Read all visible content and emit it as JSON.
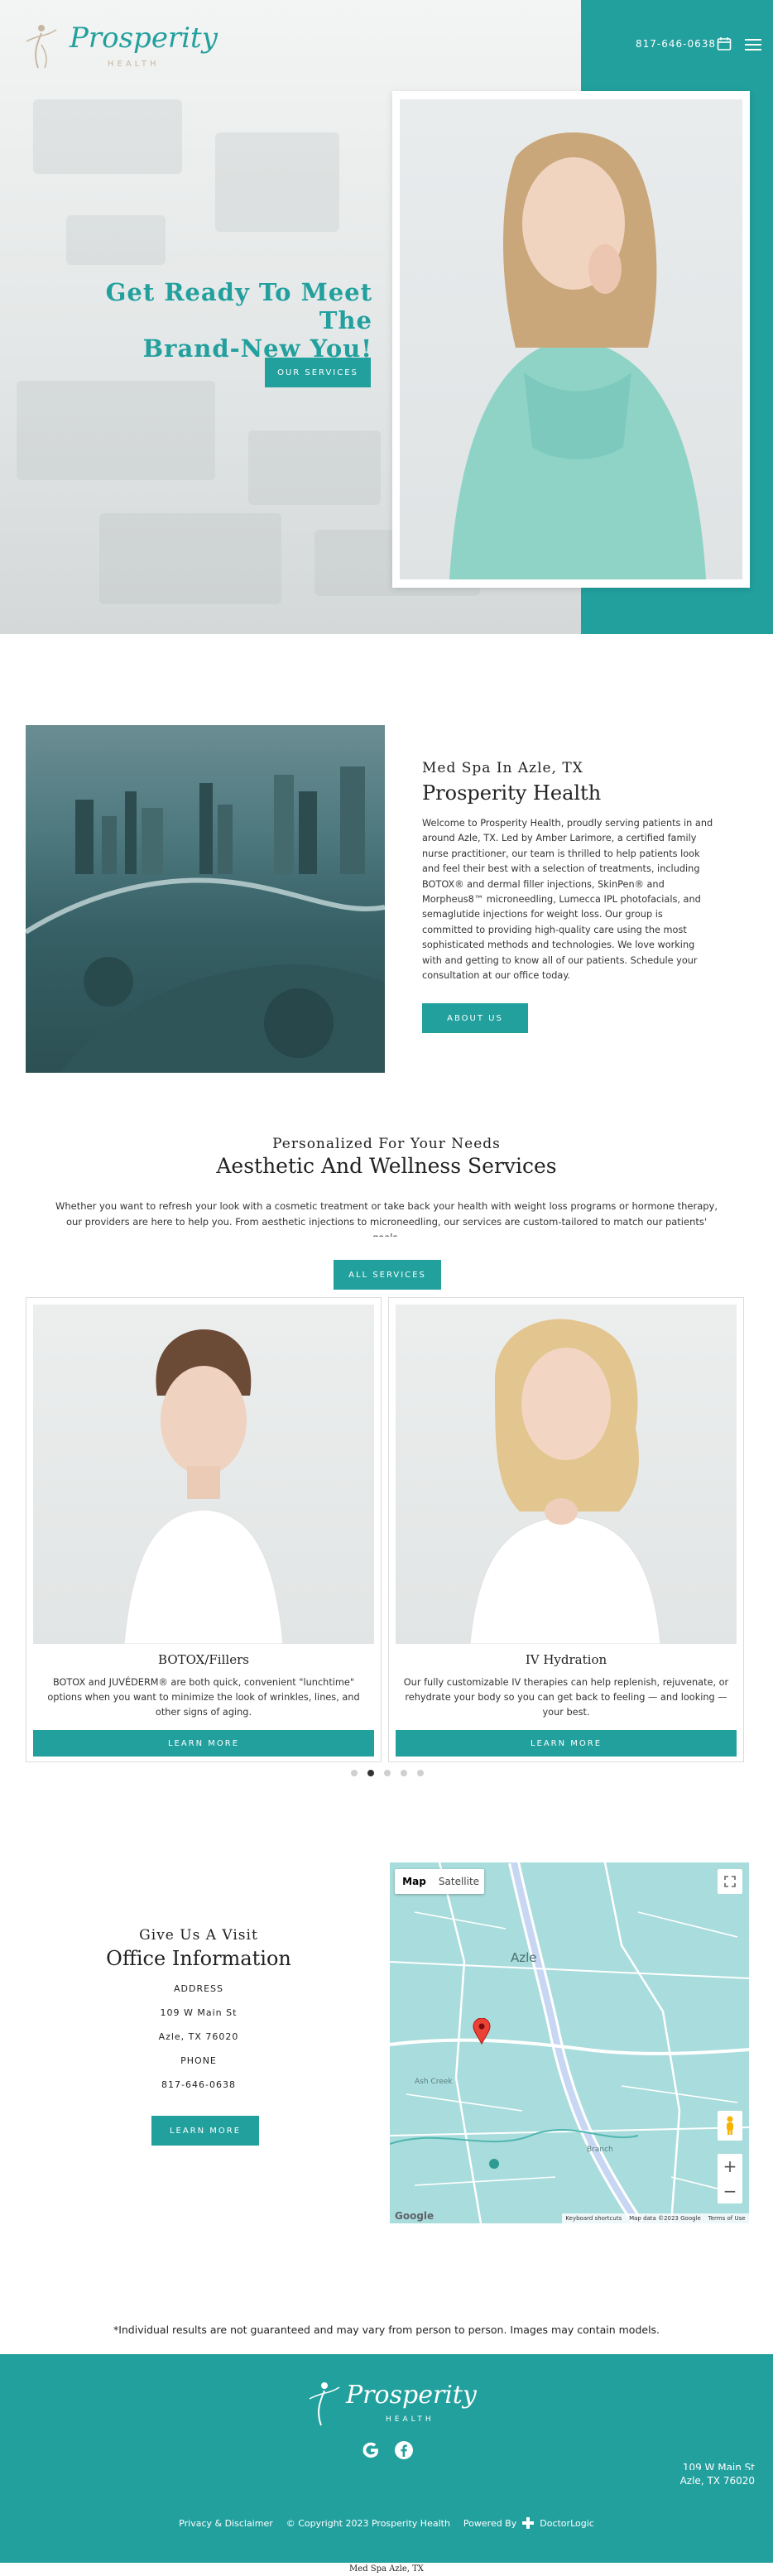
{
  "header": {
    "logo_text": "Prosperity",
    "logo_sub": "HEALTH",
    "phone": "817-646-0638",
    "calendar_icon": "calendar-icon",
    "menu_icon": "hamburger-menu-icon"
  },
  "hero": {
    "title_line1": "Get Ready To Meet The",
    "title_line2": "Brand-New You!",
    "button": "Our Services"
  },
  "about": {
    "subtitle": "Med Spa In Azle, TX",
    "title": "Prosperity Health",
    "text": "Welcome to Prosperity Health, proudly serving patients in and around Azle, TX. Led by Amber Larimore, a certified family nurse practitioner, our team is thrilled to help patients look and feel their best with a selection of treatments, including BOTOX® and dermal filler injections, SkinPen® and Morpheus8™ microneedling, Lumecca IPL photofacials, and semaglutide injections for weight loss. Our group is committed to providing high-quality care using the most sophisticated methods and technologies. We love working with and getting to know all of our patients. Schedule your consultation at our office today.",
    "button": "About Us"
  },
  "services": {
    "subtitle": "Personalized For Your Needs",
    "title": "Aesthetic And Wellness Services",
    "text": "Whether you want to refresh your look with a cosmetic treatment or take back your health with weight loss programs or hormone therapy, our providers are here to help you. From aesthetic injections to microneedling, our services are custom-tailored to match our patients' goals.",
    "button": "All Services",
    "cards": [
      {
        "title": "BOTOX/Fillers",
        "text": "BOTOX and JUVÉDERM® are both quick, convenient \"lunchtime\" options when you want to minimize the look of wrinkles, lines, and other signs of aging.",
        "button": "Learn More"
      },
      {
        "title": "IV Hydration",
        "text": "Our fully customizable IV therapies can help replenish, rejuvenate, or rehydrate your body so you can get back to feeling — and looking — your best.",
        "button": "Learn More"
      }
    ],
    "carousel_active": 2,
    "carousel_count": 5
  },
  "contact": {
    "subtitle": "Give Us A Visit",
    "title": "Office Information",
    "address_label": "ADDRESS",
    "address_line1": "109 W Main St",
    "address_line2": "Azle, TX 76020",
    "phone_label": "PHONE",
    "phone": "817-646-0638",
    "button": "Learn More"
  },
  "map": {
    "tab_map": "Map",
    "tab_satellite": "Satellite",
    "label_town": "Azle",
    "label_creek": "Ash Creek",
    "label_branch": "Branch",
    "google": "Google",
    "shortcuts": "Keyboard shortcuts",
    "mapdata": "Map data ©2023 Google",
    "terms": "Terms of Use"
  },
  "disclaimer": "*Individual results are not guaranteed and may vary from person to person. Images may contain models.",
  "footer": {
    "logo_text": "Prosperity",
    "logo_sub": "HEALTH",
    "address_line1": "109 W Main St",
    "address_line2": "Azle, TX 76020",
    "privacy": "Privacy & Disclaimer",
    "copyright": "© Copyright 2023 Prosperity Health",
    "powered": "Powered By",
    "doctorlogic": "DoctorLogic",
    "tagline": "Med Spa Azle, TX"
  },
  "colors": {
    "accent": "#22a09e",
    "dark": "#222222"
  }
}
